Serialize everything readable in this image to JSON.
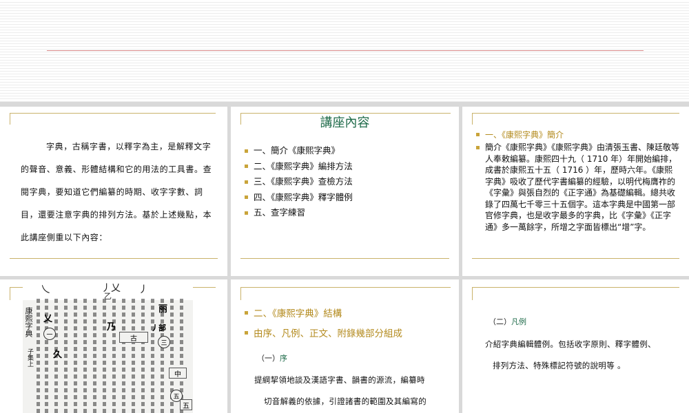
{
  "slide1": {
    "paragraph": "字典，古稱字書，以釋字為主，是解釋文字的聲音、意義、形體結構和它的用法的工具書。查閱字典，要知道它們編纂的時期、收字字數、詞目，還要注意字典的排列方法。基於上述幾點，本此講座側重以下內容："
  },
  "slide2": {
    "title": "講座內容",
    "items": [
      "一、簡介《康熙字典》",
      "二、《康熙字典》編排方法",
      "三、《康熙字典》查檢方法",
      "四、《康熙字典》釋字體例",
      "五、查字練習"
    ]
  },
  "slide3": {
    "heading": "一、《康熙字典》簡介",
    "body": "簡介《康熙字典》《康熙字典》由清張玉書、陳廷敬等人奉敕編纂。康熙四十九（ 1710 年）年開始編排，成書於康熙五十五（ 1716 ）年，歷時六年。《康熙字典》吸收了歷代字書編纂的經驗，以明代梅膺祚的《字彙》與張自烈的《正字通》為基礎編輯。總共收錄了四萬七千零三十五個字。這本字典是中國第一部官修字典，也是收字最多的字典，比《字彙》《正字通》多一萬餘字，所增之字面皆標出“增”字。"
  },
  "slide4": {
    "image": {
      "top_glyphs": [
        "乀",
        "丿乂",
        "乙",
        "丿"
      ],
      "side_label": "康熙字典",
      "side_label2": "子集上",
      "chars": [
        "丽",
        "乂",
        "乃",
        "丿部",
        "久"
      ],
      "circled": [
        "三",
        "五",
        "一"
      ],
      "boxed": [
        "古",
        "五",
        "中"
      ]
    }
  },
  "slide5": {
    "heading1": "二、《康熙字典》結構",
    "heading2": "由序、凡例、正文、附錄幾部分組成",
    "sub_num": "（一）",
    "sub_label": "序",
    "line1": "提綱挈領地談及漢語字書、韻書的源流，編纂時",
    "line2": "切音解義的依據，引證諸書的範圍及其編寫的"
  },
  "slide6": {
    "sub_num": "（二）",
    "sub_label": "凡例",
    "line1": "介紹字典編輯體例。包括收字原則、釋字體例、",
    "line2": "排列方法、特殊標記符號的說明等 。"
  }
}
